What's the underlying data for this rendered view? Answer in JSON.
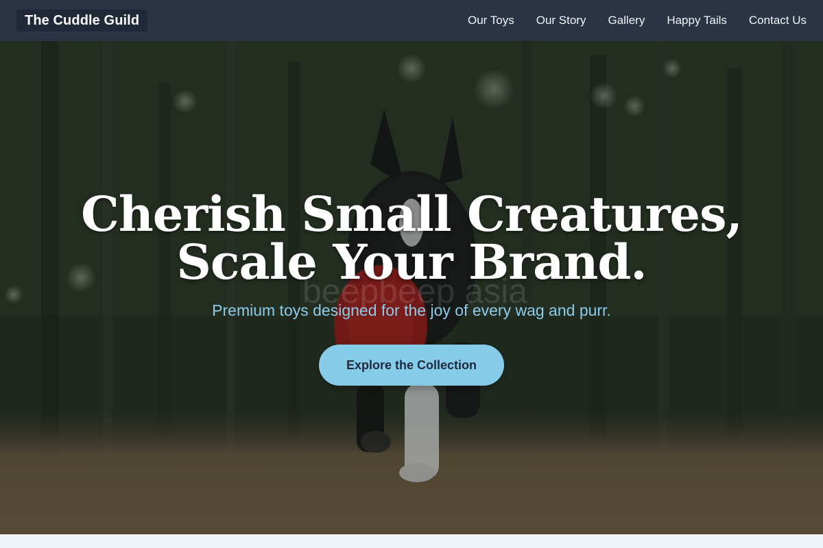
{
  "nav": {
    "brand": "The Cuddle Guild",
    "links": [
      "Our Toys",
      "Our Story",
      "Gallery",
      "Happy Tails",
      "Contact Us"
    ]
  },
  "hero": {
    "headline_line1": "Cherish Small Creatures,",
    "headline_line2": "Scale Your Brand.",
    "subheadline": "Premium toys designed for the joy of every wag and purr.",
    "cta_label": "Explore the Collection",
    "image_watermark": "beepbeep asia",
    "image_subject": "dog-running-with-red-frisbee"
  },
  "colors": {
    "navbar_bg": "#2a3444",
    "brand_bg": "#1f2937",
    "accent": "#86cce9",
    "subhead": "#8ccbea",
    "page_bg": "#f0f7fc"
  }
}
